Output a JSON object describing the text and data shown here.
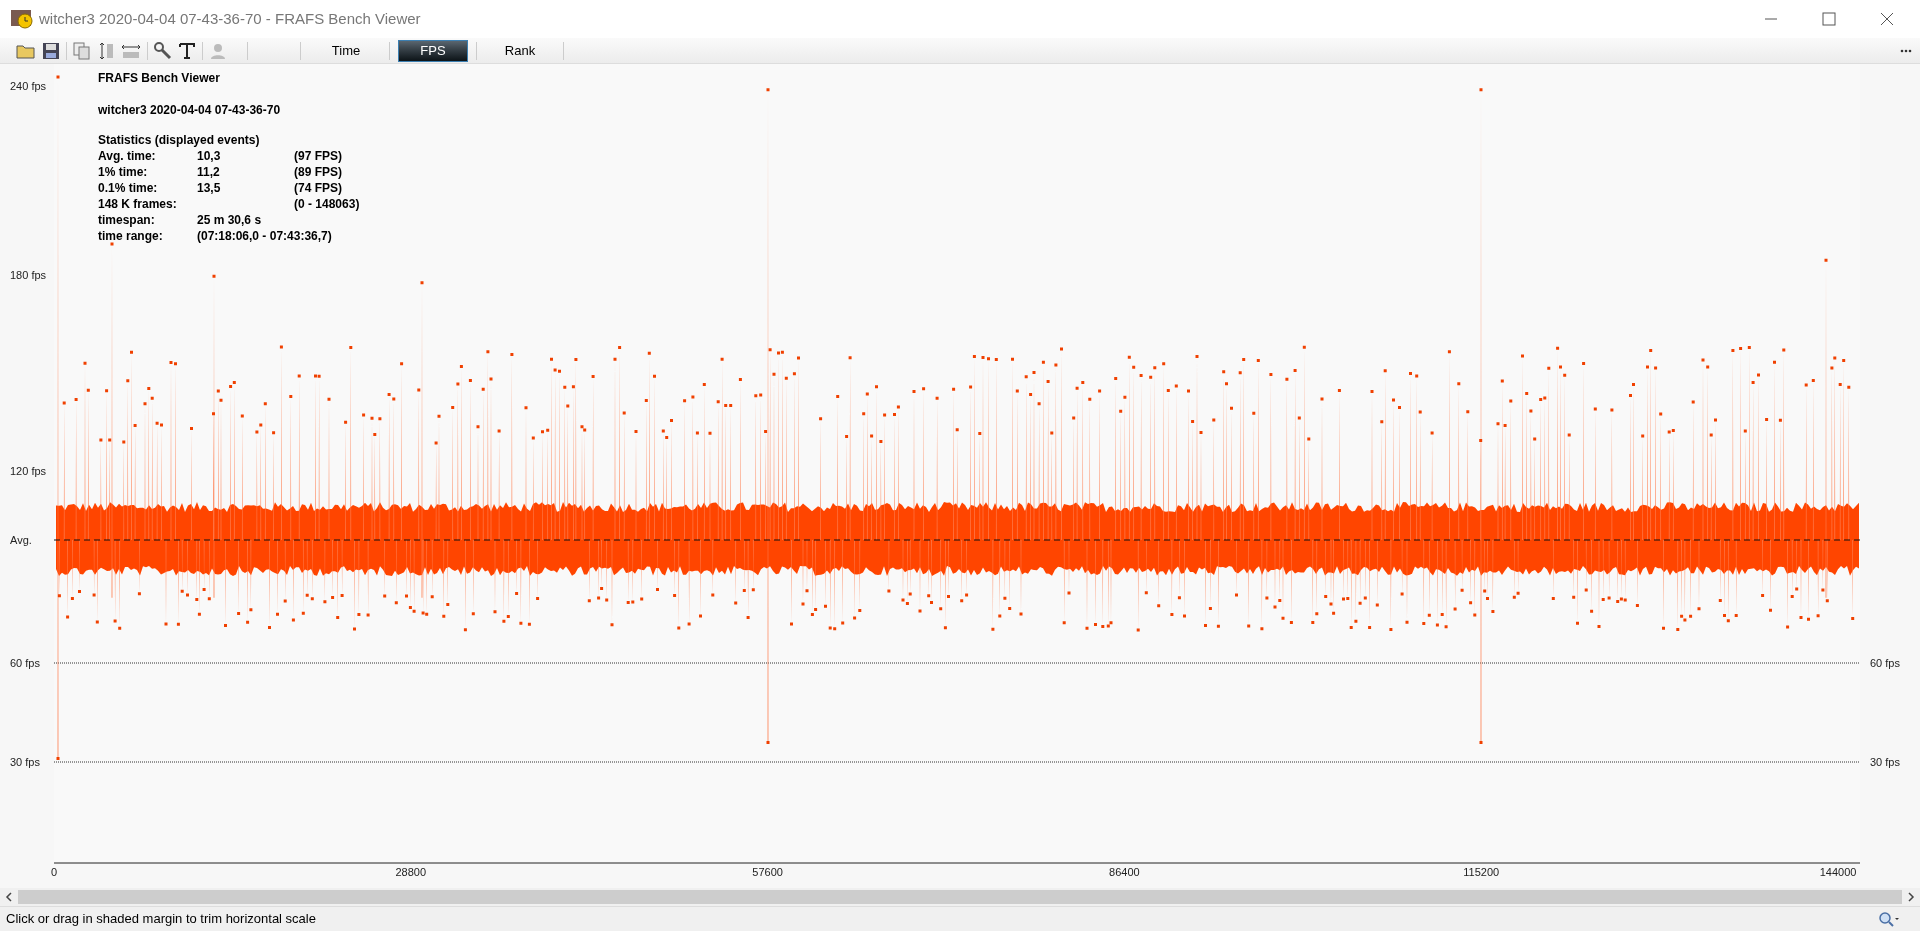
{
  "window": {
    "title": "witcher3 2020-04-04 07-43-36-70 - FRAFS Bench Viewer"
  },
  "tabs": [
    {
      "label": "Time",
      "selected": false
    },
    {
      "label": "FPS",
      "selected": true
    },
    {
      "label": "Rank",
      "selected": false
    }
  ],
  "overlay": {
    "title": "FRAFS Bench Viewer",
    "run": "witcher3 2020-04-04 07-43-36-70",
    "heading": "Statistics (displayed events)",
    "rows": [
      {
        "label": "Avg. time:",
        "value": "10,3",
        "extra": "(97 FPS)"
      },
      {
        "label": "1% time:",
        "value": "11,2",
        "extra": "(89 FPS)"
      },
      {
        "label": "0.1% time:",
        "value": "13,5",
        "extra": "(74 FPS)"
      },
      {
        "label": "148 K frames:",
        "value": "",
        "extra": "(0 - 148063)"
      },
      {
        "label": "timespan:",
        "value": "25 m 30,6 s",
        "extra": ""
      },
      {
        "label": "time range:",
        "value": "(07:18:06,0 - 07:43:36,7)",
        "extra": ""
      }
    ]
  },
  "chart": {
    "y_labels": [
      "240 fps",
      "180 fps",
      "120 fps"
    ],
    "avg_label": "Avg.",
    "guide_lines": [
      {
        "left": "60 fps",
        "right": "60 fps"
      },
      {
        "left": "30 fps",
        "right": "30 fps"
      }
    ],
    "x_labels": [
      "0",
      "28800",
      "57600",
      "86400",
      "115200",
      "144000"
    ]
  },
  "status_bar": {
    "text": "Click or drag in shaded margin to trim horizontal scale"
  }
}
